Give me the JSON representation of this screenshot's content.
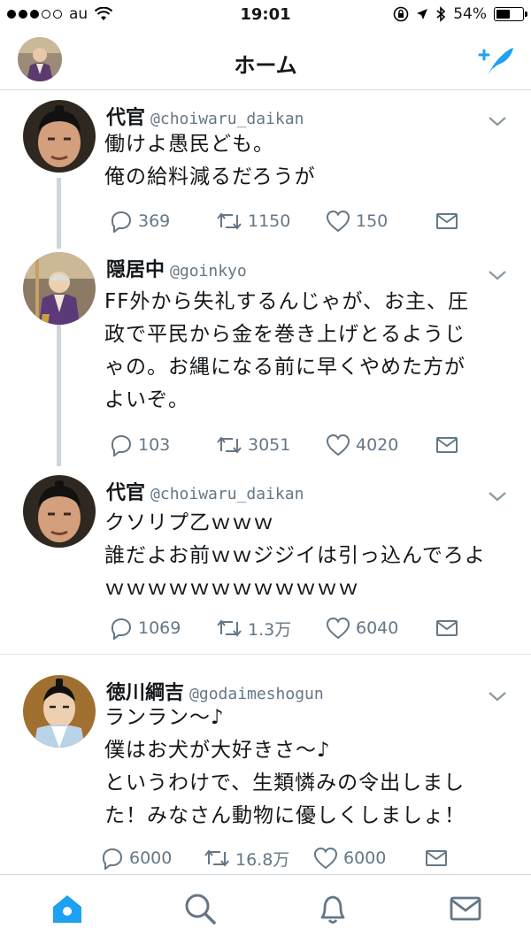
{
  "status_bar": {
    "carrier": "au",
    "time": "19:01",
    "battery_pct": "54%",
    "battery_level": 0.54
  },
  "header": {
    "title": "ホーム",
    "left_icon": "profile-avatar",
    "right_icon": "compose-tweet-icon"
  },
  "tweets": [
    {
      "name": "代官",
      "handle": "@choiwaru_daikan",
      "lines": [
        "働けよ愚民ども。",
        "俺の給料減るだろうが"
      ],
      "replies": "369",
      "retweets": "1150",
      "likes": "150"
    },
    {
      "name": "隠居中",
      "handle": "@goinkyo",
      "lines": [
        "FF外から失礼するんじゃが、お主、圧",
        "政で平民から金を巻き上げとるようじ",
        "ゃの。お縄になる前に早くやめた方が",
        "よいぞ。"
      ],
      "replies": "103",
      "retweets": "3051",
      "likes": "4020"
    },
    {
      "name": "代官",
      "handle": "@choiwaru_daikan",
      "lines": [
        "クソリプ乙ｗｗｗ",
        "誰だよお前ｗｗジジイは引っ込んでろよ",
        "ｗｗｗｗｗｗｗｗｗｗｗｗ"
      ],
      "replies": "1069",
      "retweets": "1.3万",
      "likes": "6040"
    },
    {
      "name": "徳川綱吉",
      "handle": "@godaimeshogun",
      "lines": [
        "ランラン～♪",
        "僕はお犬が大好きさ～♪",
        "というわけで、生類憐みの令出しまし",
        "た！みなさん動物に優しくしましょ！"
      ],
      "replies": "6000",
      "retweets": "16.8万",
      "likes": "6000"
    }
  ],
  "tab_bar": {
    "icons": [
      "home-icon",
      "search-icon",
      "notifications-icon",
      "messages-icon"
    ],
    "active": "home-icon"
  },
  "colors": {
    "accent": "#1da1f2",
    "text": "#14171a",
    "secondary": "#657786",
    "divider": "#e1e8ed"
  }
}
